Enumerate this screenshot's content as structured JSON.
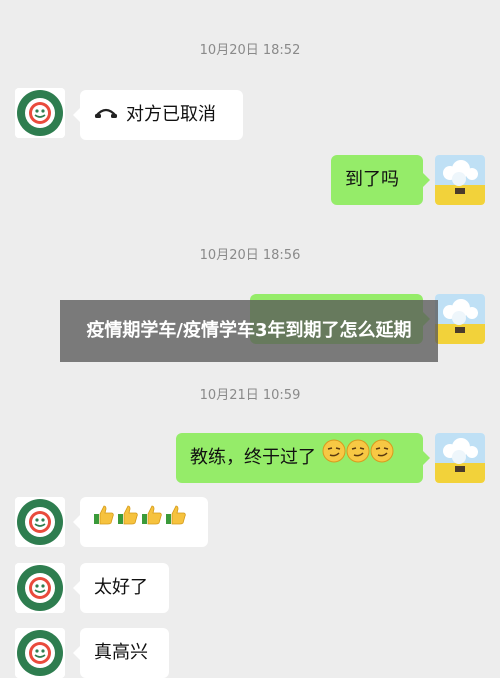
{
  "chat": {
    "timestamps": {
      "t1": "10月20日 18:52",
      "t2": "10月20日 18:56",
      "t3": "10月21日 10:59"
    },
    "messages": {
      "call_cancelled": "对方已取消",
      "arrived": "到了吗",
      "coach_passed": "教练，终于过了",
      "great": "太好了",
      "happy": "真高兴"
    },
    "icons": {
      "call": "phone-hangup-icon",
      "thumbs_up": "thumbs-up-emoji",
      "smirk": "smirk-emoji"
    }
  },
  "overlay": {
    "title": "疫情期学车/疫情学车3年到期了怎么延期"
  },
  "colors": {
    "background": "#ededed",
    "outgoing_bubble": "#95ec69",
    "incoming_bubble": "#ffffff",
    "timestamp": "#8a8a8a"
  }
}
